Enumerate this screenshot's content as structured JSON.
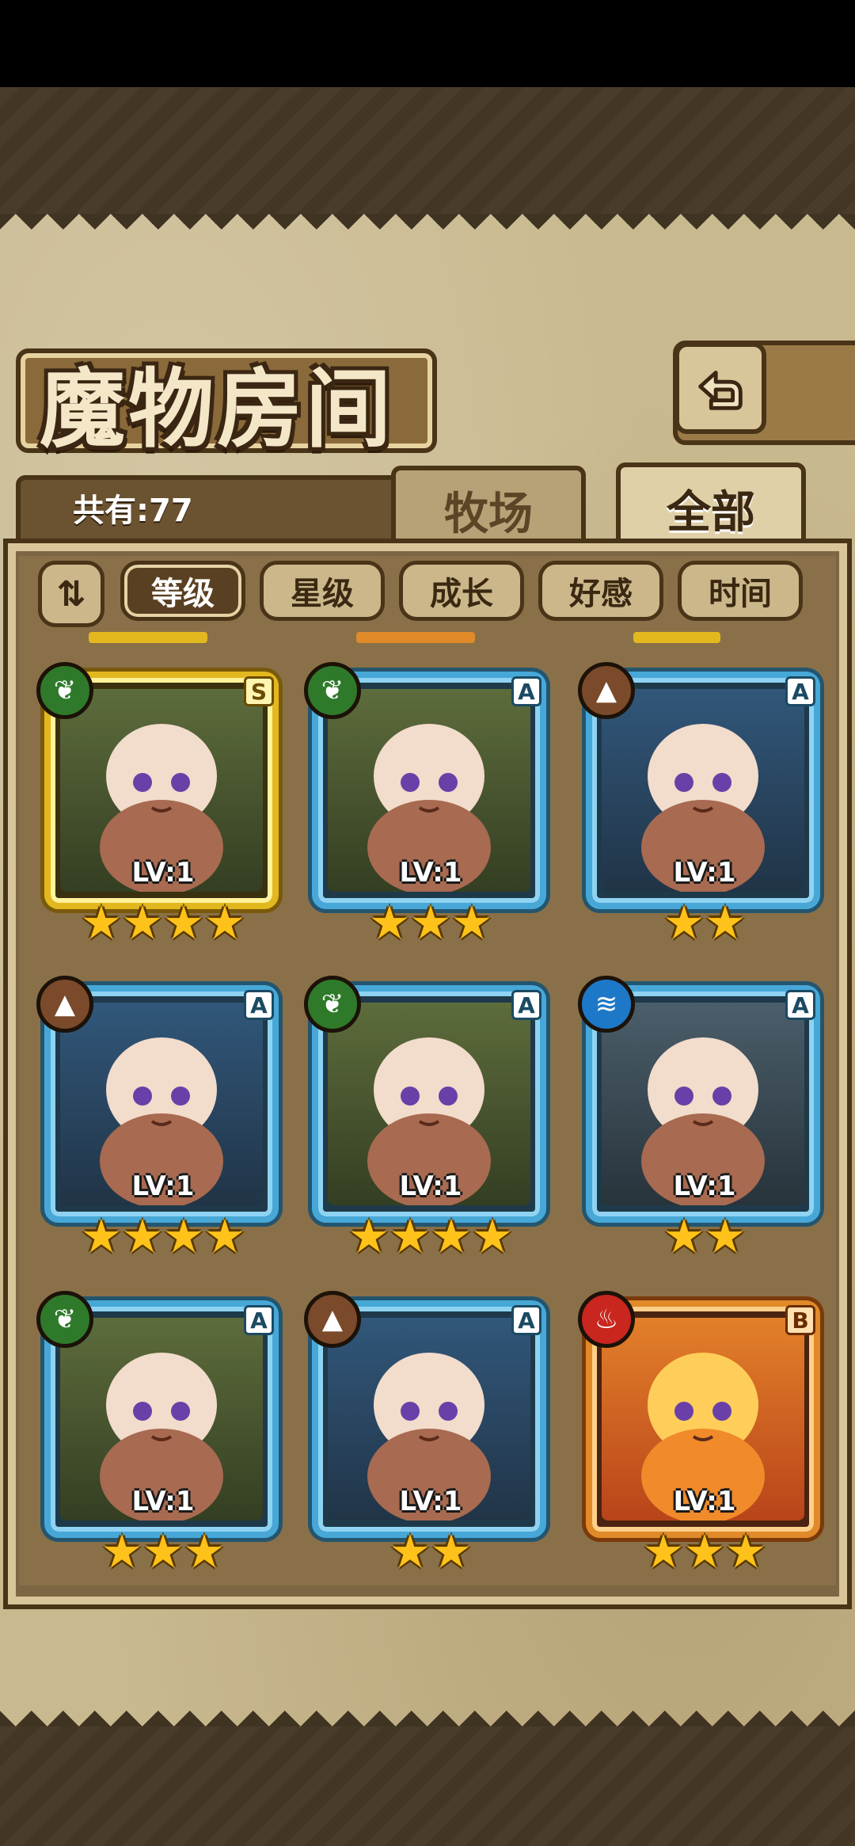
{
  "screen": {
    "title": "魔物房间",
    "count_label": "共有:77"
  },
  "tabs": {
    "ranch": "牧场",
    "all": "全部",
    "active": "all"
  },
  "sort": {
    "toggle_icon": "sort-toggle-icon",
    "options": [
      "等级",
      "星级",
      "成长",
      "好感",
      "时间"
    ],
    "active": "等级"
  },
  "cards": [
    {
      "element": "leaf",
      "rank": "S",
      "level": "LV:1",
      "stars": 4,
      "frame": "gold"
    },
    {
      "element": "leaf",
      "rank": "A",
      "level": "LV:1",
      "stars": 3,
      "frame": "blue"
    },
    {
      "element": "earth",
      "rank": "A",
      "level": "LV:1",
      "stars": 2,
      "frame": "blue"
    },
    {
      "element": "earth",
      "rank": "A",
      "level": "LV:1",
      "stars": 4,
      "frame": "blue"
    },
    {
      "element": "leaf",
      "rank": "A",
      "level": "LV:1",
      "stars": 4,
      "frame": "blue"
    },
    {
      "element": "water",
      "rank": "A",
      "level": "LV:1",
      "stars": 2,
      "frame": "blue"
    },
    {
      "element": "leaf",
      "rank": "A",
      "level": "LV:1",
      "stars": 3,
      "frame": "blue"
    },
    {
      "element": "earth",
      "rank": "A",
      "level": "LV:1",
      "stars": 2,
      "frame": "blue"
    },
    {
      "element": "fire",
      "rank": "B",
      "level": "LV:1",
      "stars": 3,
      "frame": "orange"
    }
  ],
  "colors": {
    "parchment": "#c9b98f",
    "frame_dark": "#4a3418",
    "card_blue": "#47a8d8",
    "card_gold": "#e3b81f",
    "card_orange": "#e08a2a",
    "star": "#ffc21a"
  }
}
